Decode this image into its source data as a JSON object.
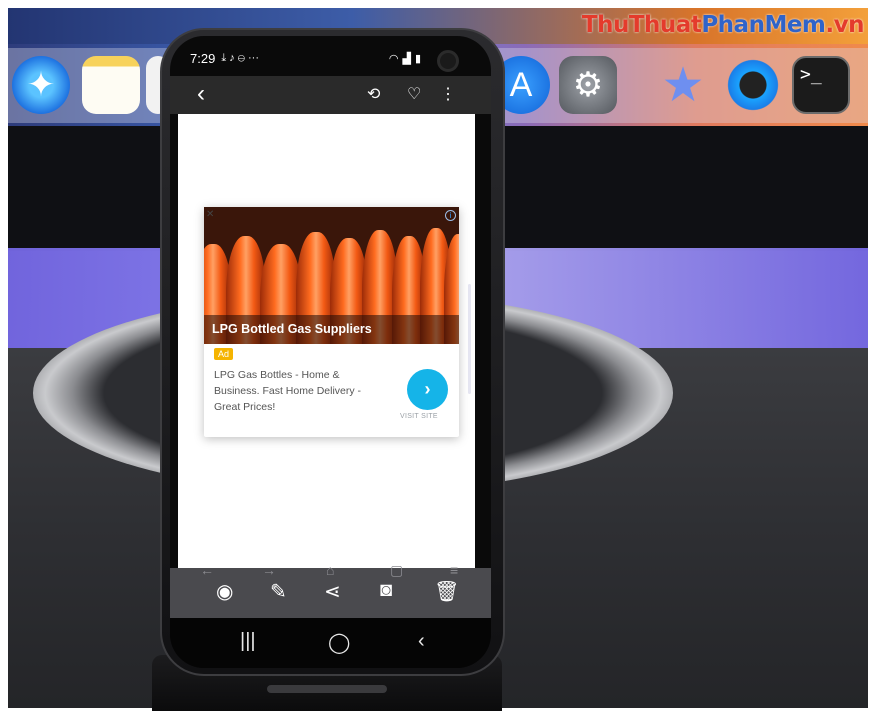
{
  "watermark": {
    "brand_a": "ThuThuat",
    "brand_b": "PhanMem",
    "suffix": ".vn"
  },
  "dock_icons": [
    "safari-icon",
    "notes-icon",
    "photos-icon",
    "app-store-icon",
    "system-preferences-icon",
    "imovie-icon",
    "quicktime-icon",
    "terminal-icon"
  ],
  "phone": {
    "status": {
      "time": "7:29",
      "indicators": "⤓ ♪ ⊖ ···",
      "right": "wifi signal battery"
    },
    "appbar": {
      "back": "‹",
      "actions": [
        "sync-icon",
        "favorite-icon",
        "more-icon"
      ]
    },
    "ad": {
      "title": "LPG Bottled Gas Suppliers",
      "badge": "Ad",
      "description": "LPG Gas Bottles - Home & Business. Fast Home Delivery - Great Prices!",
      "cta_label": "VISIT SITE",
      "cta_symbol": "›"
    },
    "toolbar": [
      "view-icon",
      "edit-icon",
      "share-icon",
      "instagram-icon",
      "delete-icon"
    ],
    "navbar": [
      "recent-apps-icon",
      "home-icon",
      "back-icon"
    ]
  },
  "colors": {
    "cta": "#15b4e8",
    "badge": "#f5b400",
    "watermark_red": "#e43b2c",
    "watermark_blue": "#2f63c9"
  }
}
